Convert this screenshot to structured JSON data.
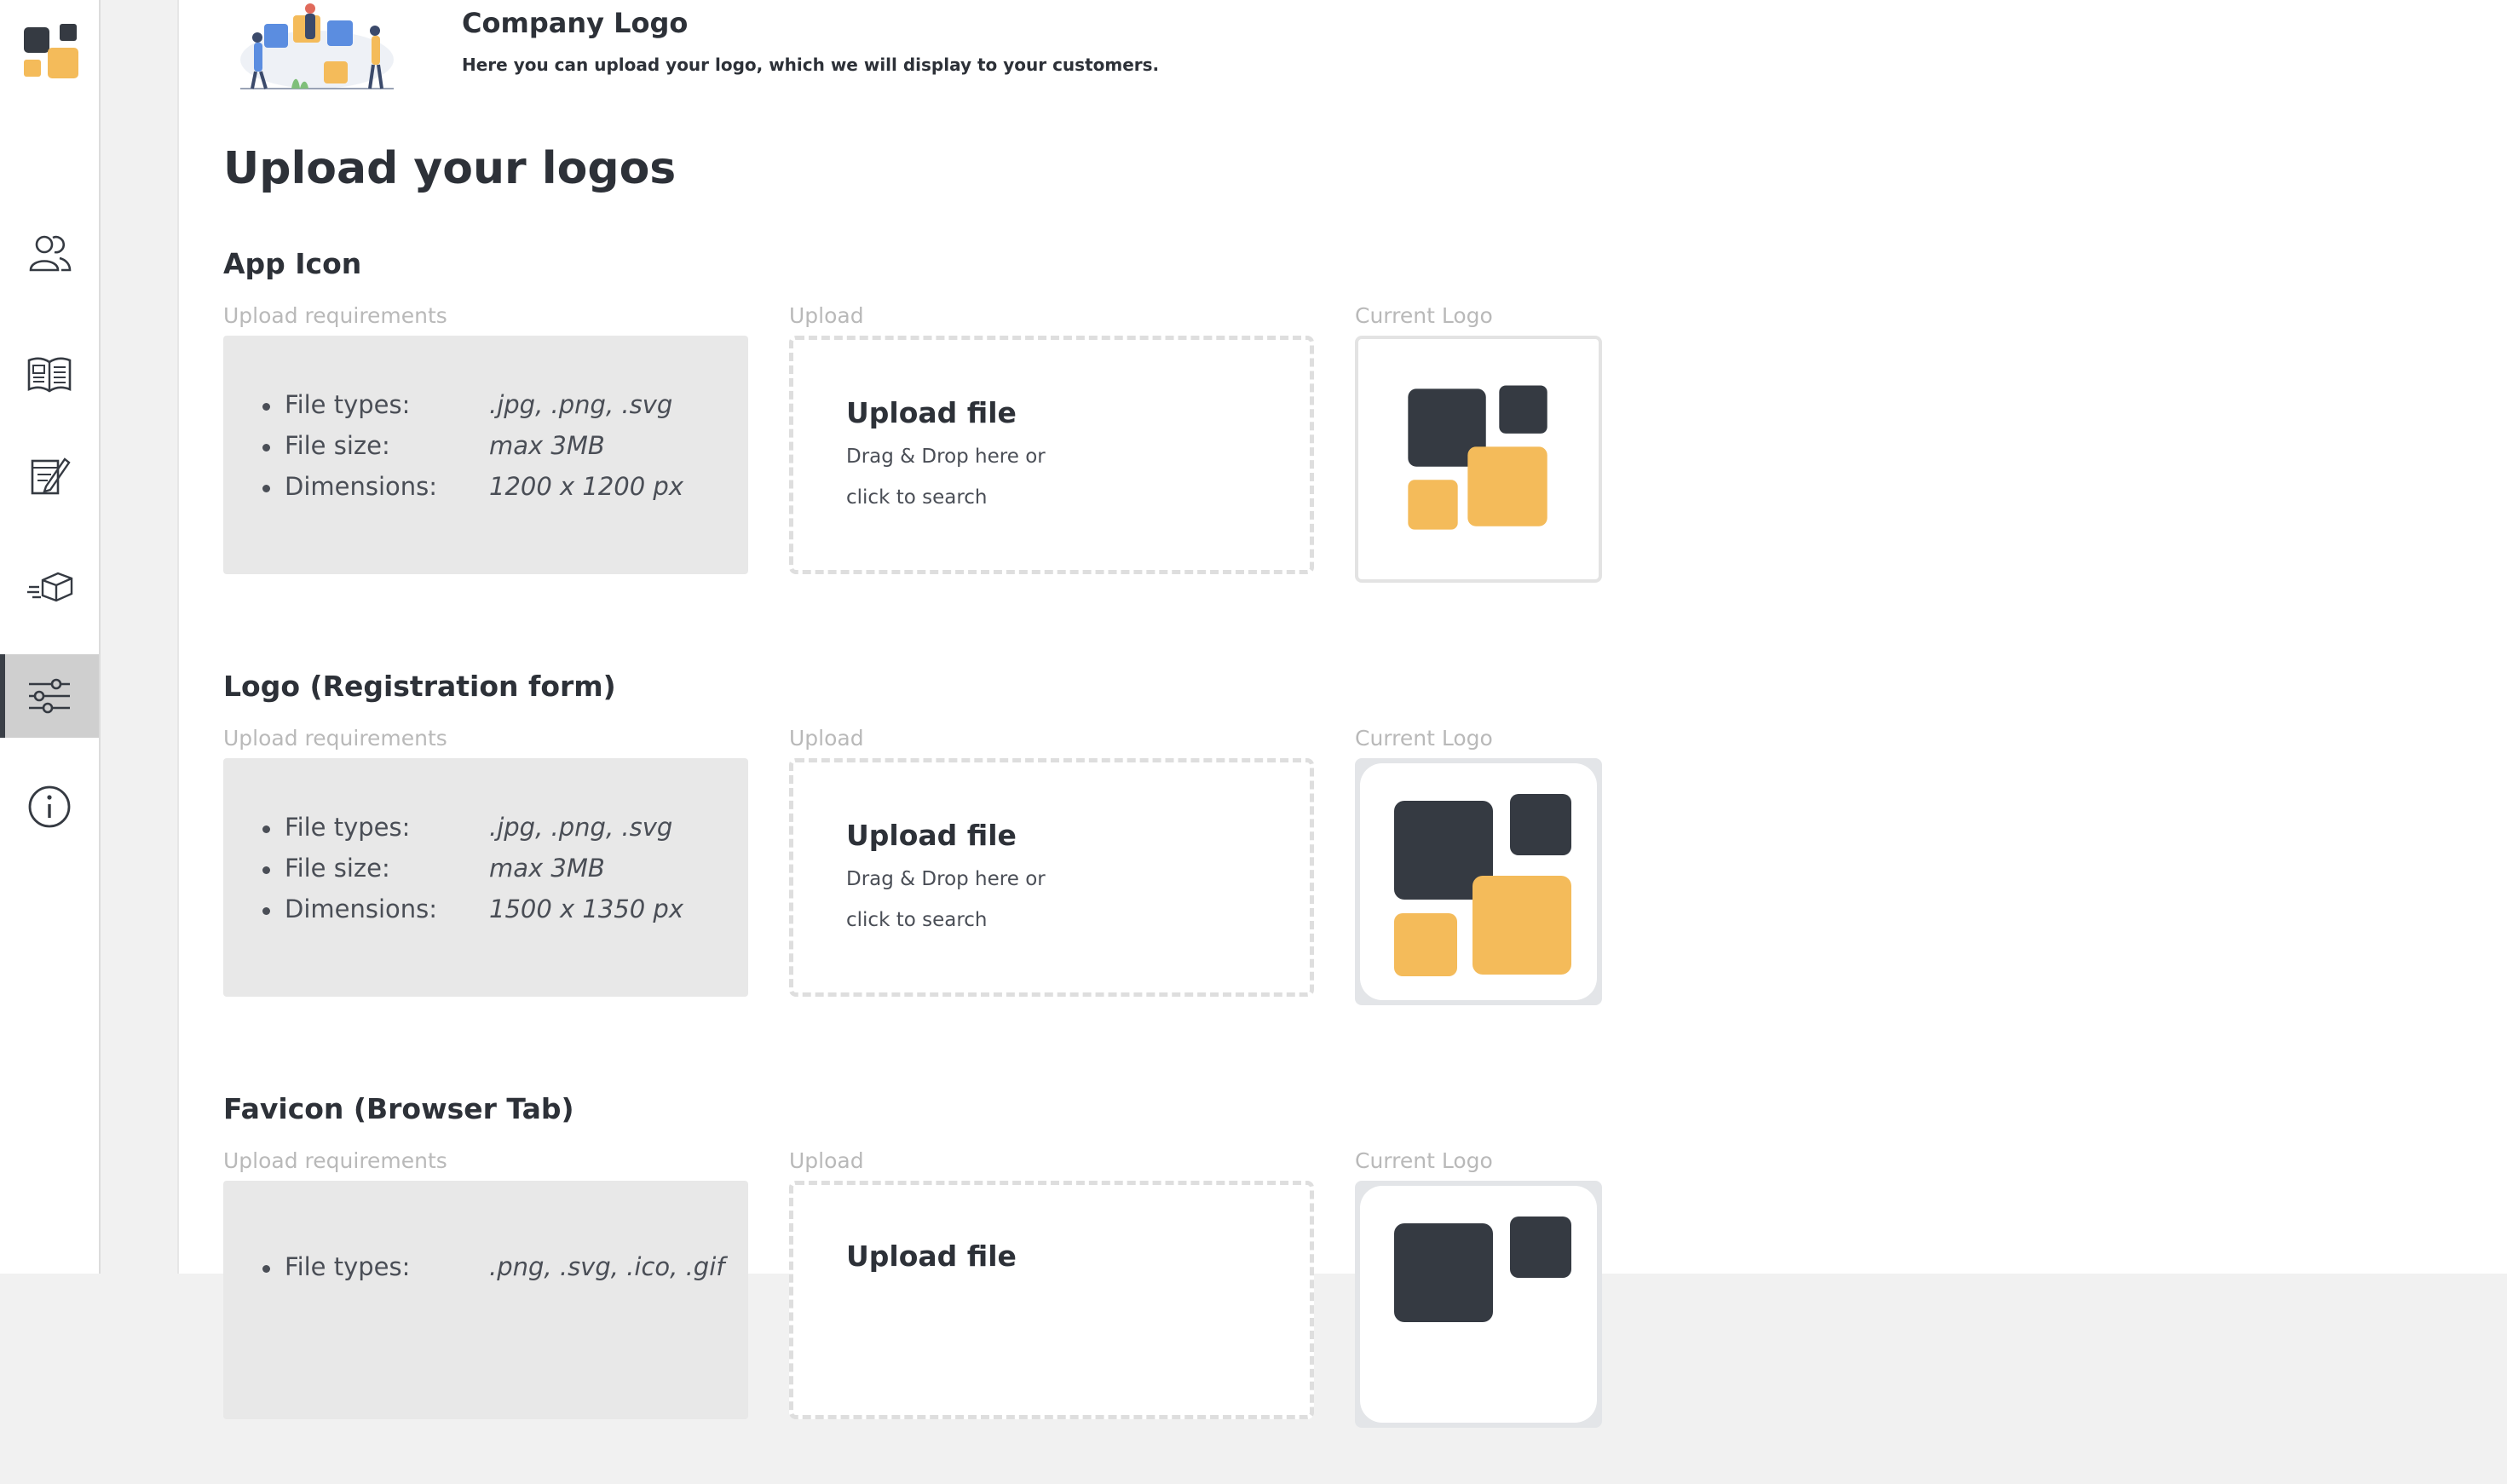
{
  "colors": {
    "dark": "#353a42",
    "accent": "#f4bb5a",
    "active_nav": "#cfcfcf"
  },
  "sidebar": {
    "items": [
      {
        "icon": "users-icon"
      },
      {
        "icon": "newspaper-icon"
      },
      {
        "icon": "form-edit-icon"
      },
      {
        "icon": "delivery-box-icon"
      },
      {
        "icon": "sliders-icon",
        "active": true
      },
      {
        "icon": "info-icon"
      }
    ]
  },
  "header": {
    "title": "Company Logo",
    "subtitle": "Here you can upload your logo, which we will display to your customers."
  },
  "page": {
    "title": "Upload your logos"
  },
  "labels": {
    "requirements": "Upload requirements",
    "upload": "Upload",
    "current_logo": "Current Logo",
    "file_types": "File types:",
    "file_size": "File size:",
    "dimensions": "Dimensions:",
    "upload_file": "Upload file",
    "drag_drop": "Drag & Drop here or",
    "click_search": "click to search"
  },
  "sections": [
    {
      "title": "App Icon",
      "file_types": ".jpg, .png, .svg",
      "file_size": "max 3MB",
      "dimensions": "1200 x 1200 px"
    },
    {
      "title": "Logo (Registration form)",
      "file_types": ".jpg, .png, .svg",
      "file_size": "max 3MB",
      "dimensions": "1500 x 1350 px"
    },
    {
      "title": "Favicon (Browser Tab)",
      "file_types": ".png, .svg, .ico, .gif"
    }
  ]
}
